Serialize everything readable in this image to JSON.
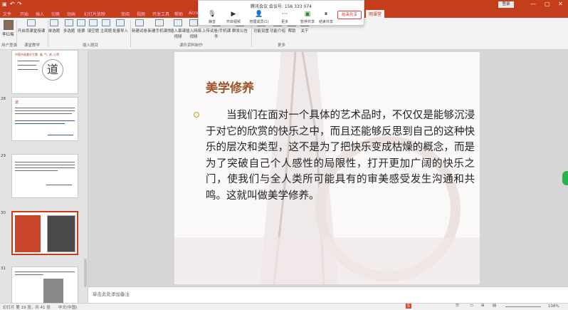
{
  "titlebar": {
    "share_label": "登录",
    "window_controls": [
      "—",
      "▢",
      "✕"
    ]
  },
  "tabs": [
    "文件",
    "开始",
    "插入",
    "切换",
    "动画",
    "幻灯片放映",
    "审阅",
    "视图",
    "开发工具",
    "帮助",
    "Acrobat",
    "雨课堂"
  ],
  "ribbon": {
    "buttons": [
      "开启雨课堂授课",
      "单选题",
      "多选题",
      "投票",
      "填空题",
      "主观题",
      "批量导入",
      "新建试卷",
      "新建手机课件",
      "插入慕课视频",
      "插入网络视频",
      "上传试卷/手机课件",
      "群发公告",
      "功能设置",
      "功能介绍",
      "帮助",
      "关于"
    ],
    "groups": [
      "用户登录",
      "课堂教学",
      "插入题目",
      "课件资料制作",
      "更多"
    ],
    "user": "李红梅"
  },
  "meeting": {
    "title": "腾讯会议 会议号: 156 333 074",
    "tools": [
      "静音",
      "开启视频",
      "管理成员(1)",
      "更多",
      "暂停共享",
      "结束共享"
    ],
    "end_label": "结束共享"
  },
  "thumbnails": [
    {
      "num": "",
      "title": "中国书画美学主题: 道, 气, 逍, 心等",
      "has_image": true
    },
    {
      "num": "28",
      "title": "道",
      "has_image": false
    },
    {
      "num": "29",
      "title": "",
      "has_image": false
    },
    {
      "num": "30",
      "title": "",
      "has_image": true
    },
    {
      "num": "31",
      "title": "",
      "has_image": true
    }
  ],
  "slide": {
    "heading": "美学修养",
    "body": "　　当我们在面对一个具体的艺术品时，不仅仅是能够沉浸于对它的欣赏的快乐之中，而且还能够反思到自己的这种快乐的层次和类型，这不是为了把快乐变成枯燥的概念，而是为了突破自己个人感性的局限性，打开更加广阔的快乐之门，使我们与全人类所可能具有的审美感受发生沟通和共鸣。这就叫做美学修养。"
  },
  "notes_placeholder": "单击此处添加备注",
  "status": {
    "left": "幻灯片 第 19 张，共 41 张",
    "lang": "中文(中国)",
    "zoom": "108%"
  },
  "colors": {
    "accent": "#c43e1c",
    "heading": "#a0532a"
  }
}
